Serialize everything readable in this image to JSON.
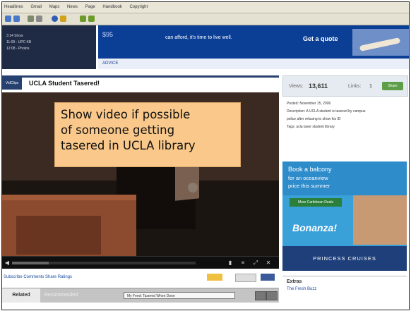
{
  "browser": {
    "bookmarks": [
      "Headlines",
      "Gmail",
      "Maps",
      "News",
      "Page",
      "Handbook",
      "Copyright"
    ]
  },
  "ad": {
    "left_lines": [
      "3:14 Show",
      "11:09 - UPC KB",
      "12:08 - Photos"
    ],
    "price": "$95",
    "text": "can afford, it's time to live well.",
    "cta": "Get a quote",
    "link": "ADVICE"
  },
  "video": {
    "section_tag": "VidClips",
    "title": "UCLA Student Tasered!",
    "overlay_note": "Show video if possible\nof someone getting\ntasered in UCLA library",
    "progress": 0.2,
    "under_text": "Subscribe   Comments   Share   Ratings",
    "tabs": {
      "related": "Related",
      "recommended": "Recommended"
    },
    "select": "My Feed: Tasered When Done"
  },
  "sidebar": {
    "views_label": "Views:",
    "views_value": "13,611",
    "links_label": "Links:",
    "links_value": "1",
    "share_label": "Share",
    "info_lines": [
      "Posted: November 15, 2006",
      "Description: A UCLA student is tasered by campus",
      "police after refusing to show his ID",
      "Tags: ucla taser student library"
    ],
    "cruise": {
      "line1": "Book a balcony",
      "line2": "for an oceanview",
      "line3": "price this summer",
      "green_btn": "More Caribbean Deals",
      "logo": "Bonanza!",
      "brand": "PRINCESS CRUISES"
    },
    "extras": {
      "title": "Extras",
      "line": "The Fresh Buzz"
    }
  },
  "colors": {
    "ad_blue": "#0b3f95",
    "title_bar": "#26406f",
    "note": "#f9c88a",
    "share_green": "#5d9e49"
  }
}
